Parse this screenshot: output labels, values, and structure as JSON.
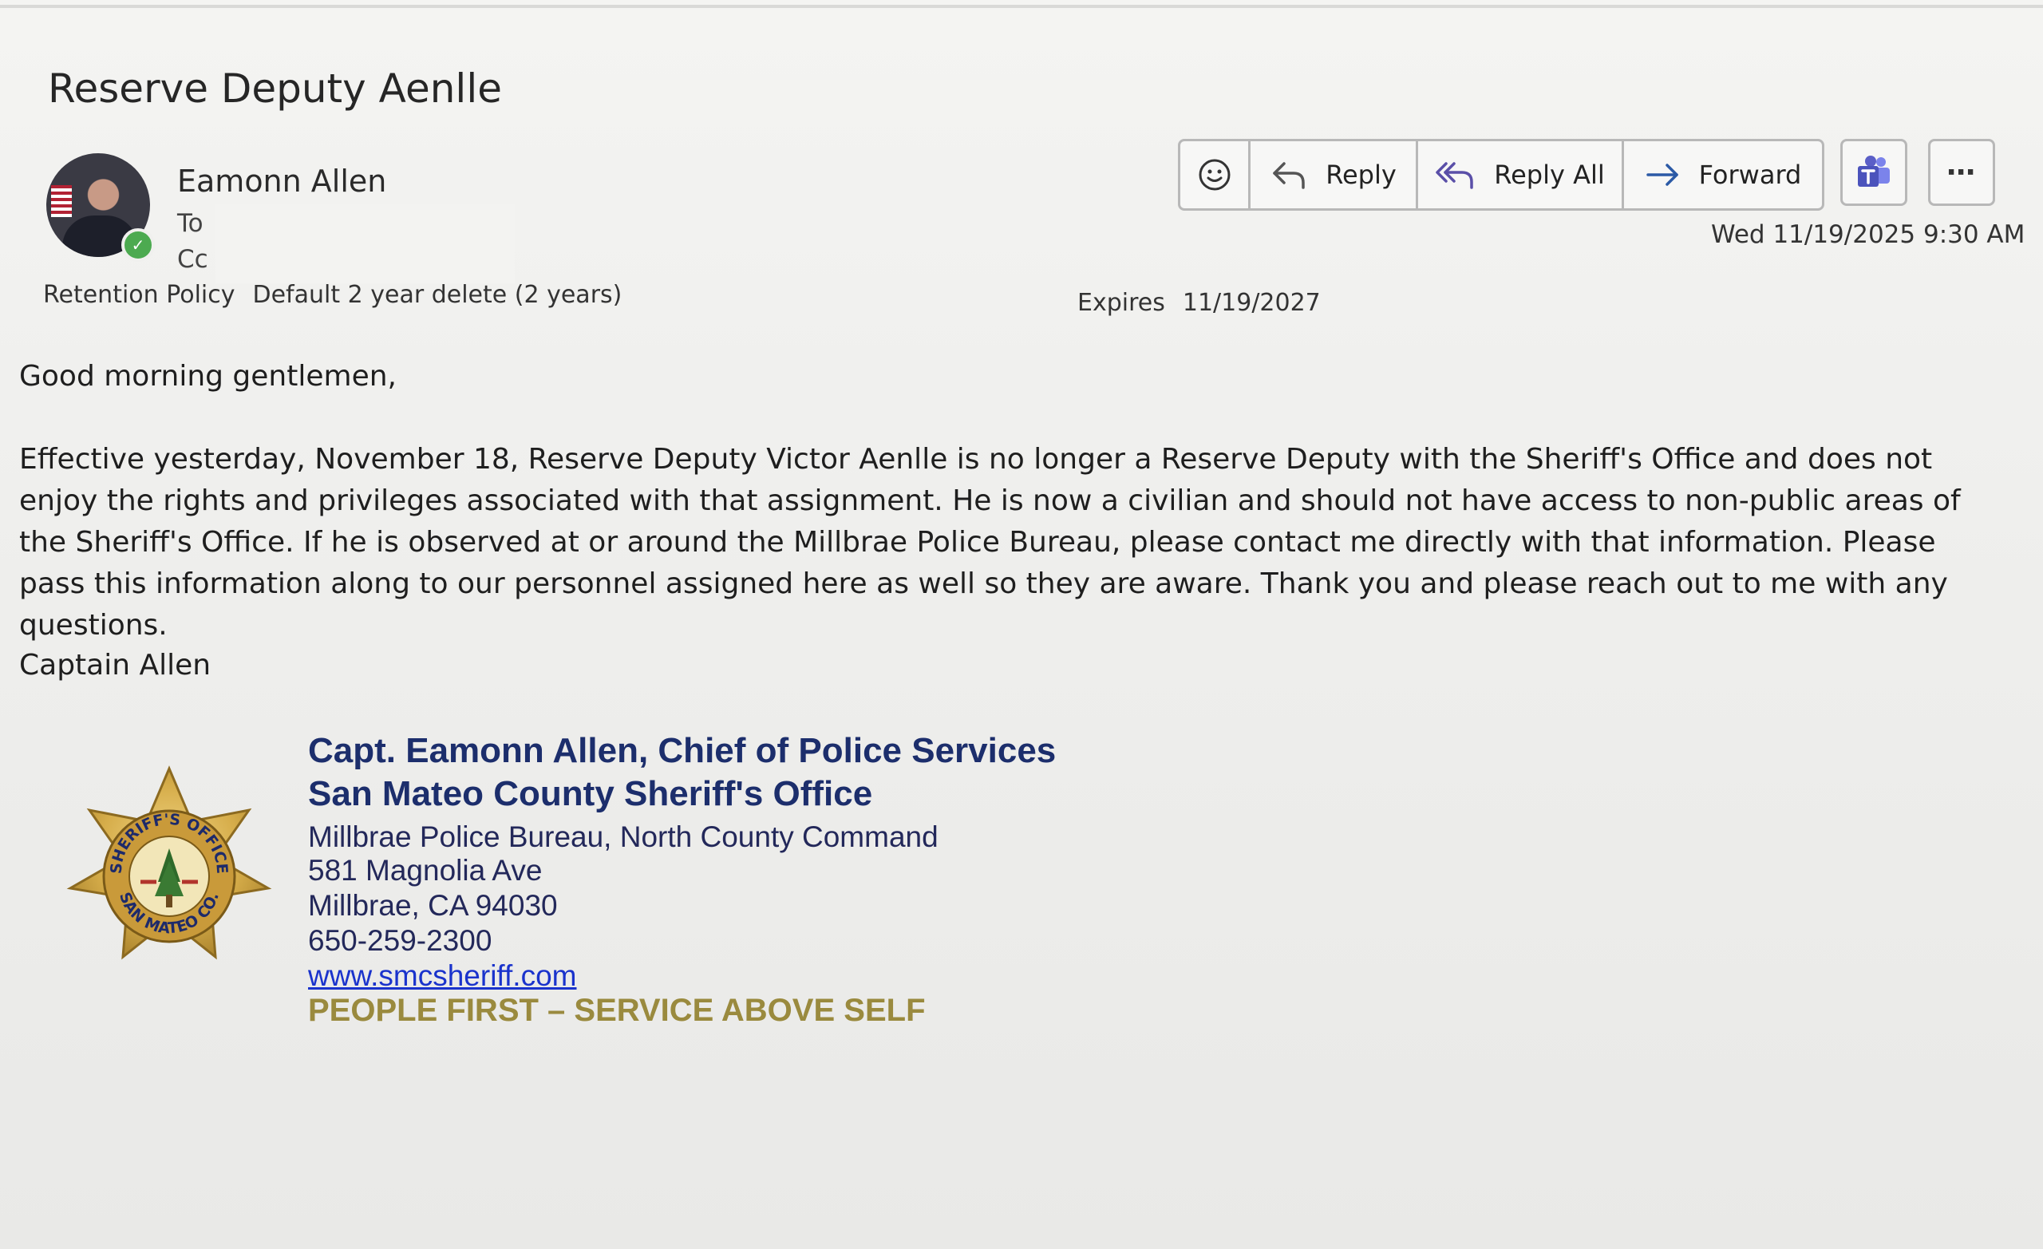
{
  "email": {
    "subject": "Reserve Deputy Aenlle",
    "sender_name": "Eamonn Allen",
    "to_label": "To",
    "cc_label": "Cc",
    "retention_label": "Retention Policy",
    "retention_value": "Default 2 year delete (2 years)",
    "expires_label": "Expires",
    "expires_value": "11/19/2027",
    "timestamp": "Wed 11/19/2025 9:30 AM",
    "presence_status": "available"
  },
  "actions": {
    "reply": "Reply",
    "reply_all": "Reply All",
    "forward": "Forward",
    "more": "⋯"
  },
  "body": {
    "greeting": "Good morning gentlemen,",
    "paragraph": "Effective yesterday, November 18, Reserve Deputy Victor Aenlle is no longer a Reserve Deputy with the Sheriff's Office and does not enjoy the rights and privileges associated with that assignment.  He is now a civilian and should not have access to non-public areas of the Sheriff's Office.  If he is observed at or around the Millbrae Police Bureau, please contact me directly with that information.  Please pass this information along to our personnel assigned here as well so they are aware.  Thank you and please reach out to me with any questions.",
    "signoff": "Captain Allen"
  },
  "signature": {
    "title": "Capt. Eamonn Allen, Chief of Police Services",
    "office": "San Mateo County Sheriff's Office",
    "bureau": "Millbrae Police Bureau, North County Command",
    "address": "581 Magnolia Ave",
    "city": "Millbrae, CA 94030",
    "phone": "650-259-2300",
    "website": "www.smcsheriff.com",
    "motto": "PEOPLE FIRST – SERVICE ABOVE SELF",
    "badge_text_top": "SHERIFF'S OFFICE",
    "badge_text_bottom": "SAN MATEO CO."
  },
  "colors": {
    "signature_blue": "#1c2e6c",
    "link_blue": "#1a33cc",
    "motto_gold": "#9a8a3e",
    "presence_green": "#4caa50",
    "teams_purple": "#5b5fc7"
  }
}
